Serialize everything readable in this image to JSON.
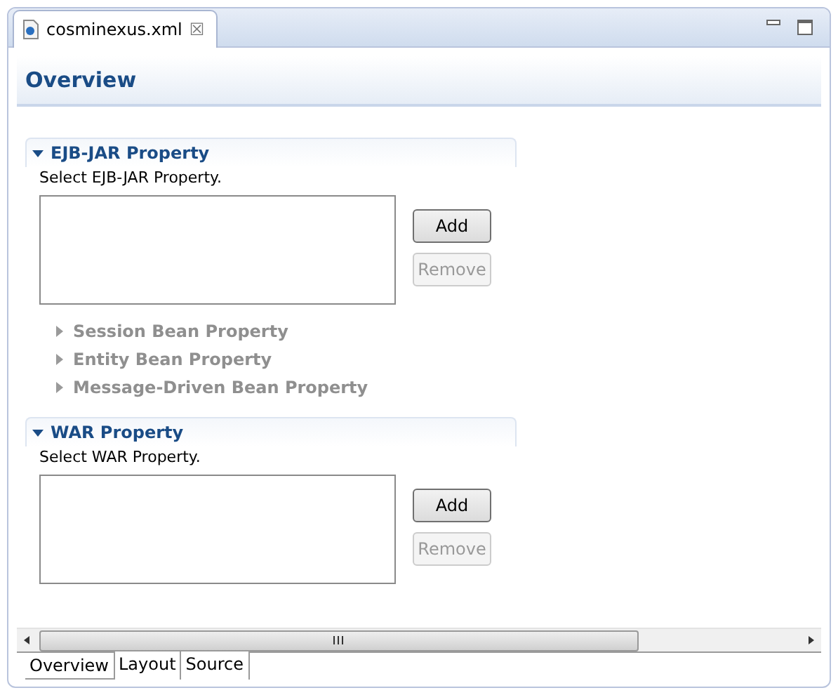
{
  "editor_tab": {
    "title": "cosminexus.xml",
    "close": "☒"
  },
  "form_title": "Overview",
  "sections": [
    {
      "title": "EJB-JAR Property",
      "expanded": true,
      "description": "Select EJB-JAR Property.",
      "buttons": [
        {
          "label": "Add",
          "disabled": false
        },
        {
          "label": "Remove",
          "disabled": true
        }
      ],
      "subsections": [
        {
          "title": "Session Bean Property",
          "expanded": false,
          "disabled": true
        },
        {
          "title": "Entity Bean Property",
          "expanded": false,
          "disabled": true
        },
        {
          "title": "Message-Driven Bean Property",
          "expanded": false,
          "disabled": true
        }
      ]
    },
    {
      "title": "WAR Property",
      "expanded": true,
      "description": "Select WAR Property.",
      "buttons": [
        {
          "label": "Add",
          "disabled": false
        },
        {
          "label": "Remove",
          "disabled": true
        }
      ]
    }
  ],
  "page_tabs": [
    {
      "label": "Overview",
      "selected": true
    },
    {
      "label": "Layout",
      "selected": false
    },
    {
      "label": "Source",
      "selected": false
    }
  ]
}
